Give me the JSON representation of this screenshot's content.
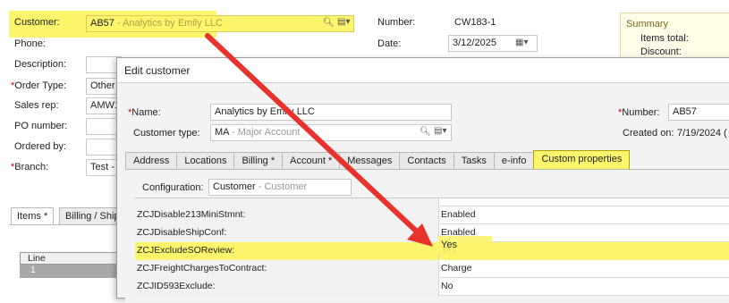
{
  "form": {
    "customer_label": "Customer:",
    "customer_code": "AB57",
    "customer_name": "Analytics by Emily LLC",
    "phone_label": "Phone:",
    "description_label": "Description:",
    "order_type_label": "Order Type:",
    "order_type_value": "Other",
    "sales_rep_label": "Sales rep:",
    "sales_rep_value": "AMW1",
    "po_label": "PO number:",
    "ordered_by_label": "Ordered by:",
    "branch_label": "Branch:",
    "branch_value": "Test -",
    "number_label": "Number:",
    "number_value": "CW183-1",
    "date_label": "Date:",
    "date_value": "3/12/2025"
  },
  "summary": {
    "title": "Summary",
    "items_total": "Items total:",
    "discount": "Discount:"
  },
  "lower_tabs": [
    "Items *",
    "Billing / Ship"
  ],
  "line_grid": {
    "header": "Line",
    "row1": "1"
  },
  "dialog": {
    "title": "Edit customer",
    "name_label": "Name:",
    "name_value": "Analytics by Emily LLC",
    "type_label": "Customer type:",
    "type_code": "MA",
    "type_name": "Major Account",
    "number_label": "Number:",
    "number_value": "AB57",
    "created_label": "Created on:",
    "created_value": "7/19/2024 (",
    "tabs": [
      "Address",
      "Locations",
      "Billing *",
      "Account *",
      "Messages",
      "Contacts",
      "Tasks",
      "e-info",
      "Custom properties"
    ],
    "config_label": "Configuration:",
    "config_code": "Customer",
    "config_name": "Customer",
    "rows": [
      {
        "name": "ZCJDisable213MiniStmnt:",
        "value": "Enabled"
      },
      {
        "name": "ZCJDisableShipConf:",
        "value": "Enabled"
      },
      {
        "name": "ZCJExcludeSOReview:",
        "value": "Yes"
      },
      {
        "name": "ZCJFreightChargesToContract:",
        "value": "Charge"
      },
      {
        "name": "ZCJID593Exclude:",
        "value": "No"
      }
    ]
  },
  "colors": {
    "highlight": "#fdf56b",
    "arrow": "#e8322e",
    "required": "#c00000"
  }
}
